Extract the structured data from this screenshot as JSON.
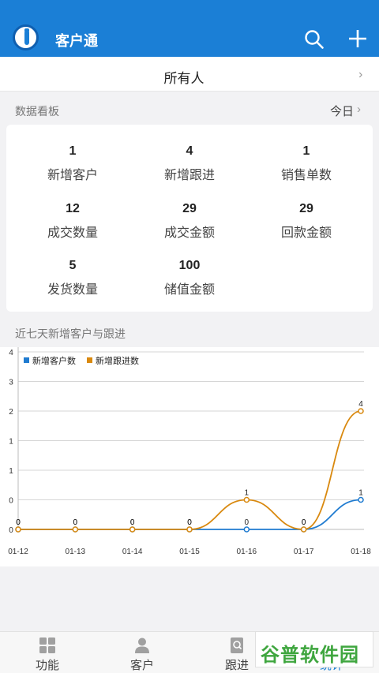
{
  "header": {
    "title": "客户通",
    "search_icon": "search-icon",
    "add_icon": "plus-icon"
  },
  "owner_filter": {
    "label": "所有人"
  },
  "dashboard": {
    "section_label": "数据看板",
    "period": "今日",
    "stats": [
      {
        "value": "1",
        "label": "新增客户"
      },
      {
        "value": "4",
        "label": "新增跟进"
      },
      {
        "value": "1",
        "label": "销售单数"
      },
      {
        "value": "12",
        "label": "成交数量"
      },
      {
        "value": "29",
        "label": "成交金额"
      },
      {
        "value": "29",
        "label": "回款金额"
      },
      {
        "value": "5",
        "label": "发货数量"
      },
      {
        "value": "100",
        "label": "储值金额"
      }
    ]
  },
  "chart_section": {
    "label": "近七天新增客户与跟进"
  },
  "chart_data": {
    "type": "line",
    "x": [
      "01-12",
      "01-13",
      "01-14",
      "01-15",
      "01-16",
      "01-17",
      "01-18"
    ],
    "series": [
      {
        "name": "新增客户数",
        "values": [
          0,
          0,
          0,
          0,
          0,
          0,
          1
        ],
        "color": "#1f7bd0",
        "labels": []
      },
      {
        "name": "新增跟进数",
        "values": [
          0,
          0,
          0,
          0,
          1,
          0,
          4
        ],
        "color": "#d9890f",
        "labels": []
      }
    ],
    "y_ticks": [
      "0",
      "0",
      "1",
      "1",
      "2",
      "3",
      "4"
    ],
    "grid": true,
    "legend": "top-left"
  },
  "tabbar": {
    "tabs": [
      {
        "label": "功能",
        "icon": "grid-icon"
      },
      {
        "label": "客户",
        "icon": "person-icon"
      },
      {
        "label": "跟进",
        "icon": "notebook-icon"
      },
      {
        "label": "统计",
        "icon": "chart-icon"
      }
    ]
  },
  "watermark": {
    "text": "谷普软件园"
  },
  "colors": {
    "primary": "#1b7fd6",
    "series_customers": "#1f7bd0",
    "series_followups": "#d9890f"
  }
}
